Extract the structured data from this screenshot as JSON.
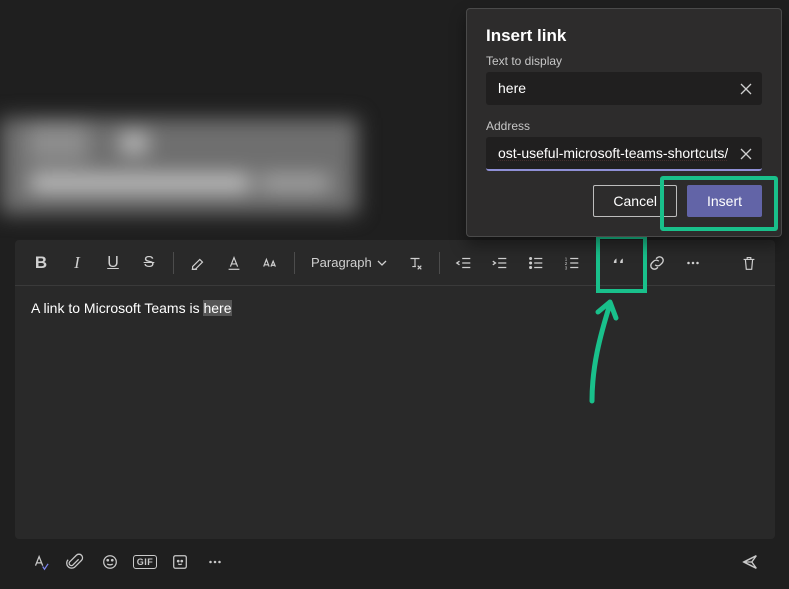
{
  "popup": {
    "title": "Insert link",
    "text_label": "Text to display",
    "text_value": "here",
    "address_label": "Address",
    "address_value": "ost-useful-microsoft-teams-shortcuts/",
    "cancel": "Cancel",
    "insert": "Insert"
  },
  "toolbar": {
    "paragraph_label": "Paragraph",
    "items": {
      "bold": "B",
      "italic": "I",
      "underline": "U",
      "strike": "S"
    }
  },
  "editor": {
    "line_prefix": "A link to Microsoft Teams is ",
    "selected_word": "here"
  },
  "bottombar": {
    "gif": "GIF"
  }
}
